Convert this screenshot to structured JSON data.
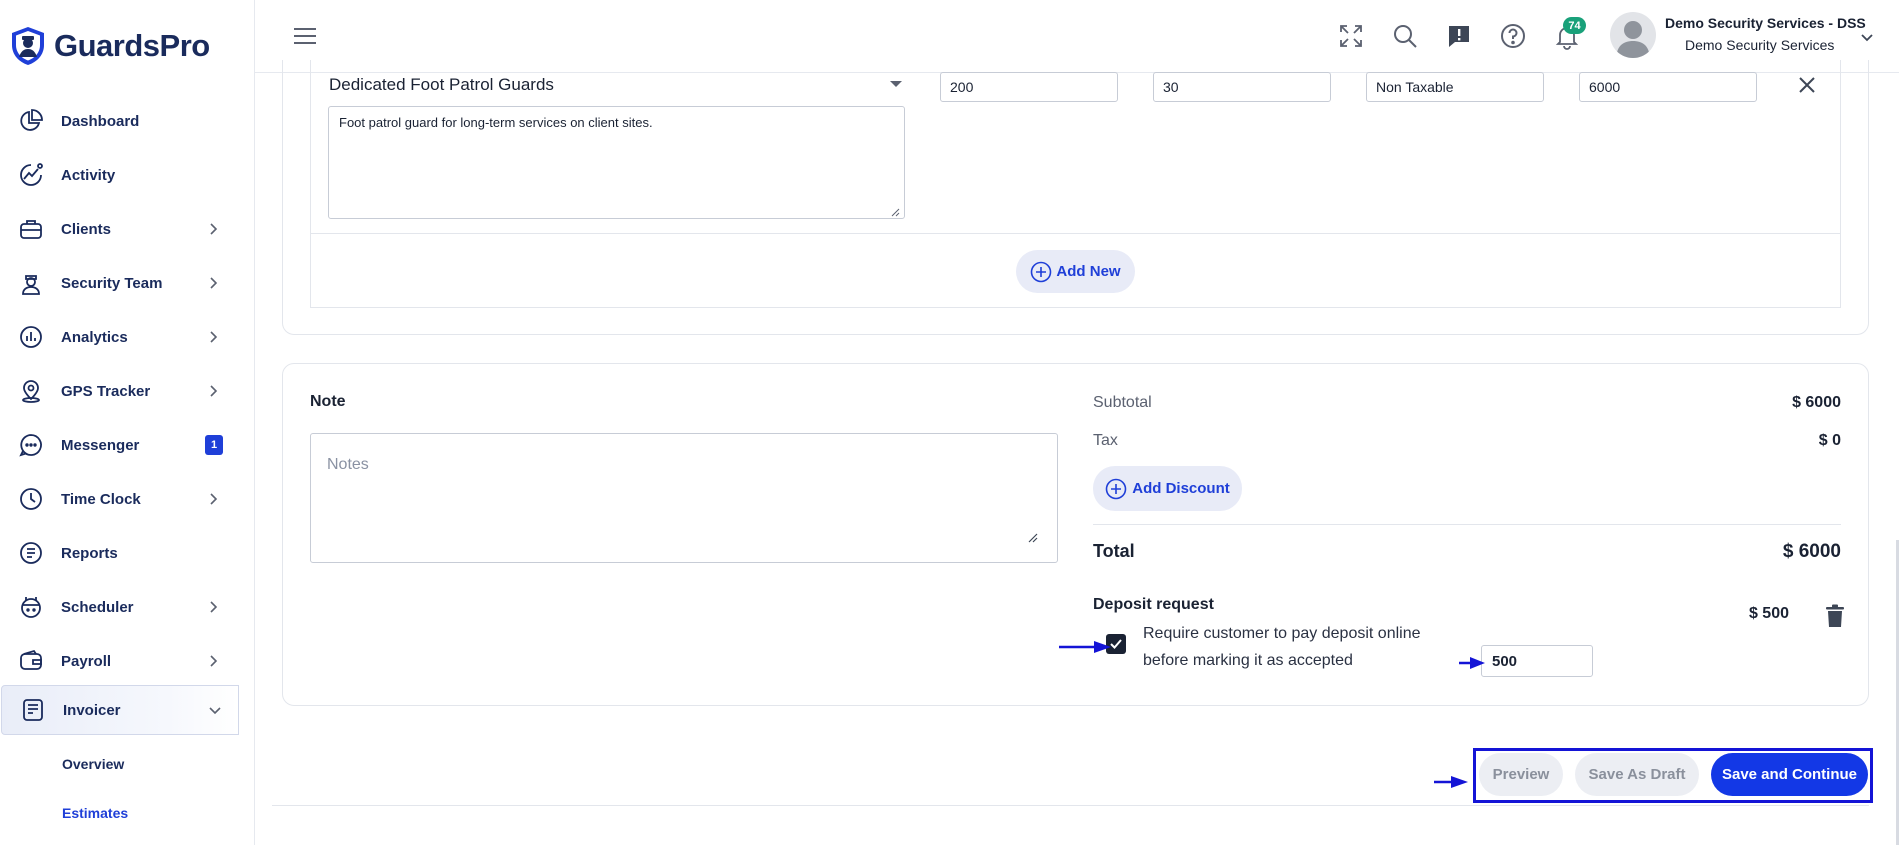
{
  "app": {
    "logo_text": "GuardsPro",
    "accent_color": "#1f3fd8",
    "primary_button_color": "#1338e6",
    "annotation_color": "#1414d6"
  },
  "sidebar": {
    "items": [
      {
        "label": "Dashboard",
        "icon": "dashboard-pie-icon"
      },
      {
        "label": "Activity",
        "icon": "activity-chart-icon"
      },
      {
        "label": "Clients",
        "icon": "briefcase-icon",
        "expandable": true
      },
      {
        "label": "Security Team",
        "icon": "guard-icon",
        "expandable": true
      },
      {
        "label": "Analytics",
        "icon": "analytics-icon",
        "expandable": true
      },
      {
        "label": "GPS Tracker",
        "icon": "location-pin-icon",
        "expandable": true
      },
      {
        "label": "Messenger",
        "icon": "chat-bubble-icon",
        "badge": "1"
      },
      {
        "label": "Time Clock",
        "icon": "clock-icon",
        "expandable": true
      },
      {
        "label": "Reports",
        "icon": "report-icon"
      },
      {
        "label": "Scheduler",
        "icon": "calendar-icon",
        "expandable": true
      },
      {
        "label": "Payroll",
        "icon": "wallet-icon",
        "expandable": true
      },
      {
        "label": "Invoicer",
        "icon": "invoice-icon",
        "expanded": true,
        "active": true
      }
    ],
    "subitems": [
      {
        "label": "Overview"
      },
      {
        "label": "Estimates",
        "current": true
      }
    ]
  },
  "header": {
    "icons": [
      "fullscreen-icon",
      "search-icon",
      "feedback-icon",
      "help-icon",
      "bell-icon"
    ],
    "notification_count": "74",
    "user_name": "Demo Security Services - DSS",
    "user_org": "Demo Security Services"
  },
  "line_item": {
    "name": "Dedicated Foot Patrol Guards",
    "description": "Foot patrol guard for long-term services on client sites.",
    "fields": [
      "200",
      "30",
      "Non Taxable",
      "6000"
    ],
    "add_new_label": "Add New"
  },
  "summary": {
    "note_label": "Note",
    "note_placeholder": "Notes",
    "subtotal_label": "Subtotal",
    "subtotal_value": "$ 6000",
    "tax_label": "Tax",
    "tax_value": "$ 0",
    "add_discount_label": "Add Discount",
    "total_label": "Total",
    "total_value": "$ 6000",
    "deposit_label": "Deposit request",
    "deposit_amount": "$ 500",
    "deposit_checkbox_text": "Require customer to pay deposit online before marking it as accepted",
    "deposit_checked": true,
    "deposit_input_value": "500"
  },
  "footer": {
    "preview_label": "Preview",
    "draft_label": "Save As Draft",
    "save_label": "Save and Continue"
  }
}
